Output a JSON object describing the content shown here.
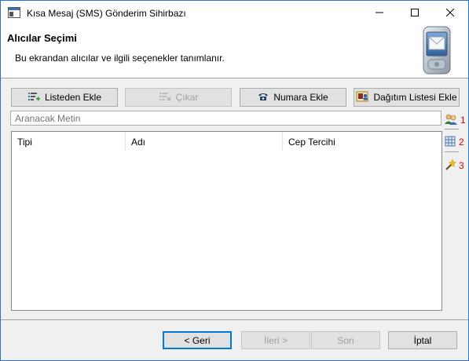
{
  "window": {
    "title": "Kısa Mesaj (SMS) Gönderim Sihirbazı",
    "icons": [
      "app-window-icon",
      "minimize-icon",
      "maximize-icon",
      "close-icon"
    ]
  },
  "header": {
    "title": "Alıcılar Seçimi",
    "description": "Bu ekrandan alıcılar ve ilgili seçenekler tanımlanır.",
    "graphic_icon": "pda-mail-icon"
  },
  "toolbar": {
    "add_from_list": "Listeden Ekle",
    "remove": "Çıkar",
    "add_number": "Numara Ekle",
    "distribution_list": "Dağıtım Listesi Ekle"
  },
  "search": {
    "placeholder": "Aranacak Metin"
  },
  "list": {
    "columns": [
      "Tipi",
      "Adı",
      "Cep Tercihi"
    ],
    "rows": []
  },
  "side_tools": [
    {
      "icon": "users-icon",
      "number": "1"
    },
    {
      "icon": "grid-icon",
      "number": "2"
    },
    {
      "icon": "magic-wand-icon",
      "number": "3"
    }
  ],
  "nav": {
    "back": "< Geri",
    "next": "İleri >",
    "finish": "Son",
    "cancel": "İptal"
  },
  "colors": {
    "accent": "#0078d7",
    "number_red": "#e00000",
    "disabled_text": "#a0a0a0"
  }
}
